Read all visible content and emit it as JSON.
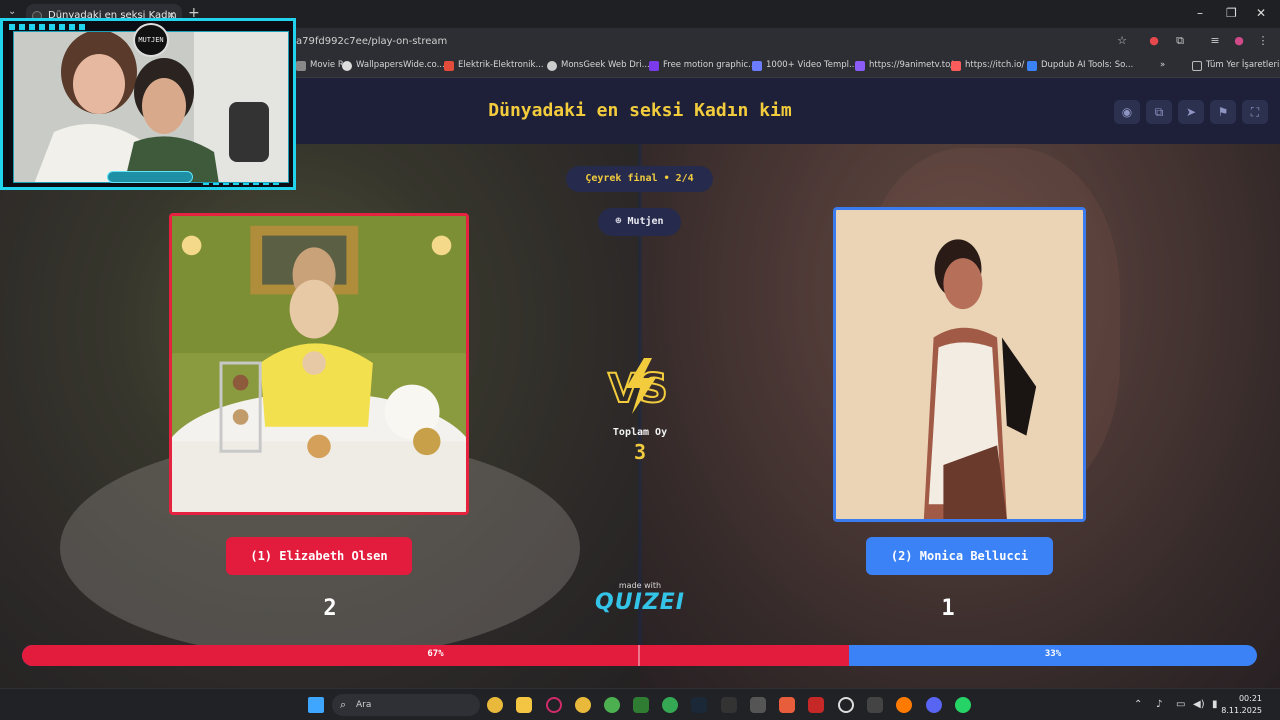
{
  "browser": {
    "tab_title": "Dünyadaki en seksi Kadın",
    "url": "a79fd992c7ee/play-on-stream",
    "bookmarks": [
      {
        "label": "Movie R...",
        "color": "#888888"
      },
      {
        "label": "WallpapersWide.co...",
        "color": "#dddddd"
      },
      {
        "label": "Elektrik-Elektronik...",
        "color": "#e34b3b"
      },
      {
        "label": "MonsGeek Web Dri...",
        "color": "#cccccc"
      },
      {
        "label": "Free motion graphic...",
        "color": "#7c3aed"
      },
      {
        "label": "1000+ Video Templ...",
        "color": "#6b7cff"
      },
      {
        "label": "https://9animetv.to/",
        "color": "#8b5cf6"
      },
      {
        "label": "https://itch.io/",
        "color": "#fa5c5c"
      },
      {
        "label": "Dupdub AI Tools: So...",
        "color": "#3b82f6"
      }
    ],
    "all_bookmarks": "Tüm Yer İşaretleri"
  },
  "game": {
    "title": "Dünyadaki en seksi Kadın kim",
    "round_label": "Çeyrek final • 2/4",
    "host_label": "Mutjen",
    "total_label": "Toplam Oy",
    "total_votes": "3",
    "left": {
      "label": "(1) Elizabeth Olsen",
      "votes": "2",
      "percent_text": "67%",
      "percent": 67
    },
    "right": {
      "label": "(2) Monica Bellucci",
      "votes": "1",
      "percent_text": "33%",
      "percent": 33
    },
    "made_with": "made with",
    "brand": "QUIZEI"
  },
  "taskbar": {
    "search_placeholder": "Ara",
    "time": "00:21",
    "date": "8.11.2025"
  },
  "webcam": {
    "logo_text": "MUTJEN"
  },
  "colors": {
    "accent_yellow": "#f2cc3d",
    "red": "#e31b3c",
    "blue": "#3b82f6",
    "cyan": "#22d3ee"
  }
}
